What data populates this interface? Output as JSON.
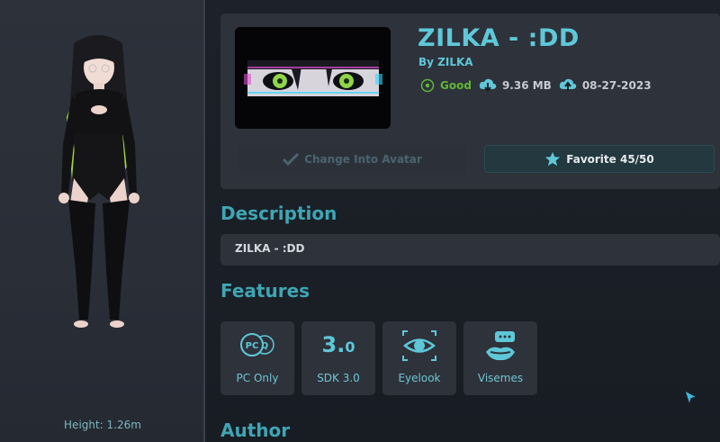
{
  "preview": {
    "height_label": "Height: 1.26m"
  },
  "avatar": {
    "title": "ZILKA - :DD",
    "byline": "By ZILKA",
    "performance": "Good",
    "size": "9.36 MB",
    "date": "08-27-2023"
  },
  "buttons": {
    "change_into": "Change Into Avatar",
    "favorite": "Favorite 45/50"
  },
  "sections": {
    "description": "Description",
    "features": "Features",
    "author": "Author"
  },
  "description_text": "ZILKA - :DD",
  "features": [
    {
      "label": "PC Only",
      "icon": "pc-quest-icon"
    },
    {
      "label": "SDK 3.0",
      "icon": "sdk-3-icon",
      "sdk_main": "3.",
      "sdk_minor": "0"
    },
    {
      "label": "Eyelook",
      "icon": "eyelook-icon"
    },
    {
      "label": "Visemes",
      "icon": "visemes-icon"
    }
  ],
  "colors": {
    "accent": "#5ec8d8",
    "good": "#5fb836",
    "panel": "#2e323b",
    "background": "#1b1f27"
  }
}
